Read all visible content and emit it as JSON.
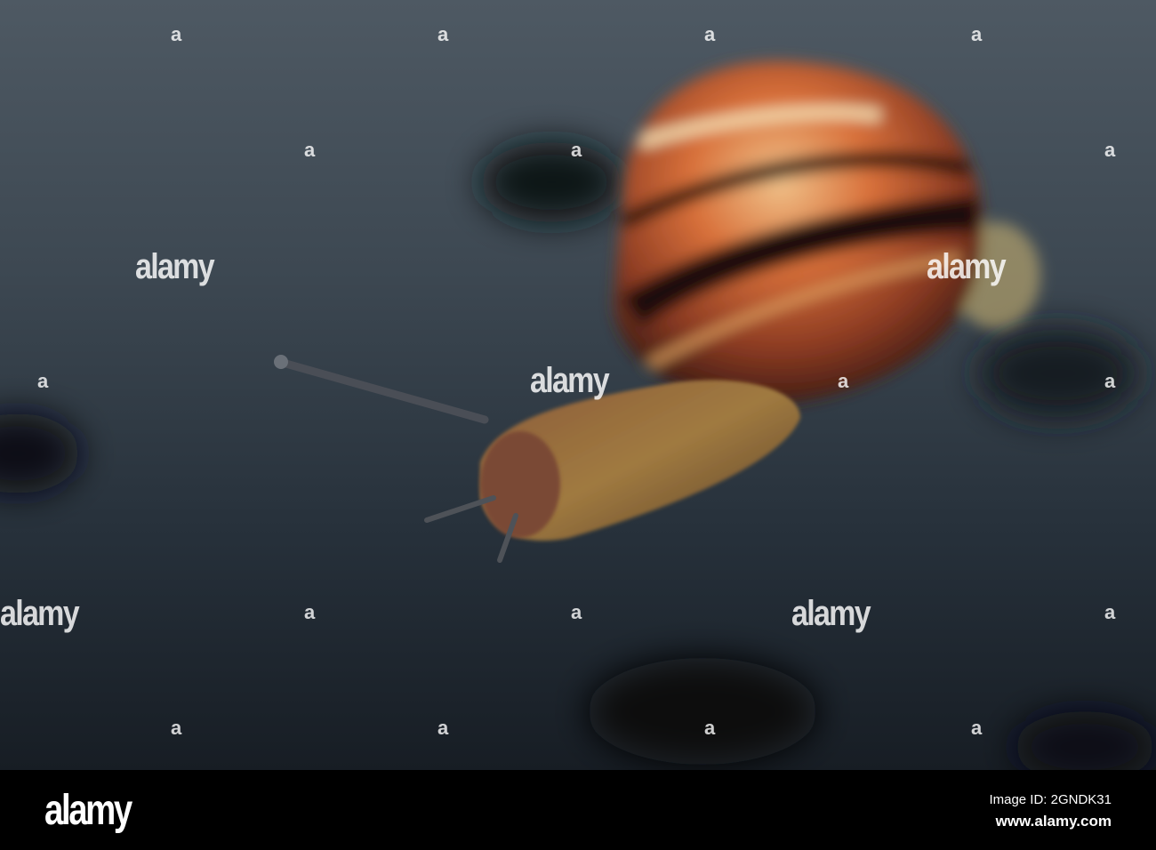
{
  "watermark": {
    "text": "alamy",
    "mark": "a"
  },
  "footer": {
    "logo": "alamy",
    "image_id": "Image ID: 2GNDK31",
    "url": "www.alamy.com"
  },
  "colors": {
    "background_top": "#5c6670",
    "background_bottom": "#1c2228",
    "shell_orange": "#d8703a",
    "shell_dark": "#2a1410"
  }
}
